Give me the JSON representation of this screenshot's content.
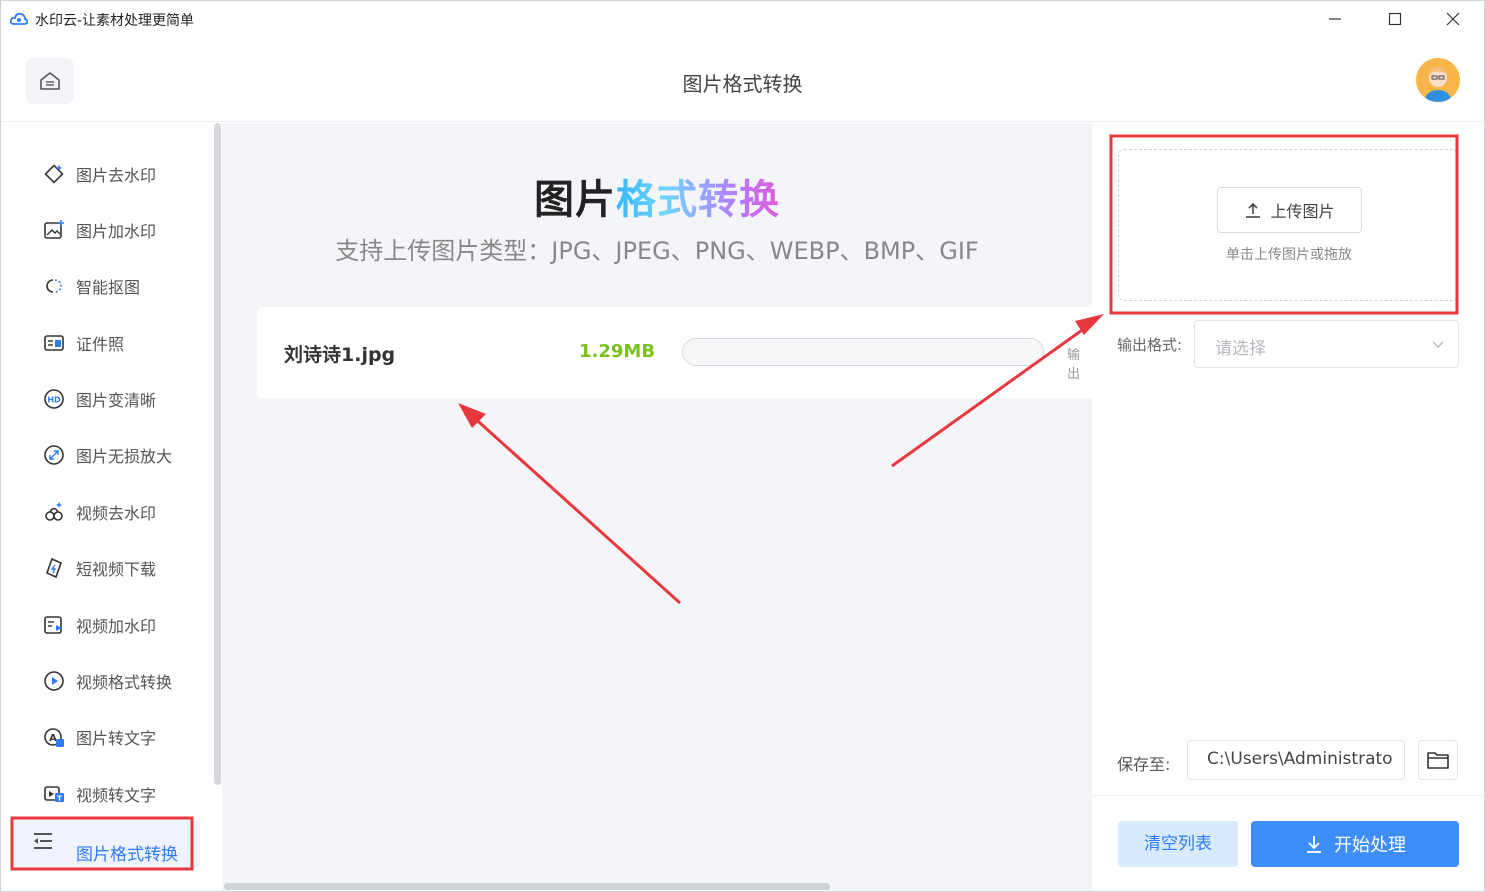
{
  "window": {
    "title": "水印云-让素材处理更简单"
  },
  "header": {
    "title": "图片格式转换"
  },
  "sidebar": {
    "items": [
      {
        "label": "图片去水印",
        "icon": "eraser-icon"
      },
      {
        "label": "图片加水印",
        "icon": "image-add-icon"
      },
      {
        "label": "智能抠图",
        "icon": "cutout-icon"
      },
      {
        "label": "证件照",
        "icon": "id-card-icon"
      },
      {
        "label": "图片变清晰",
        "icon": "hd-icon"
      },
      {
        "label": "图片无损放大",
        "icon": "enlarge-icon"
      },
      {
        "label": "视频去水印",
        "icon": "video-eraser-icon"
      },
      {
        "label": "短视频下载",
        "icon": "video-download-icon"
      },
      {
        "label": "视频加水印",
        "icon": "video-add-icon"
      },
      {
        "label": "视频格式转换",
        "icon": "play-circle-icon"
      },
      {
        "label": "图片转文字",
        "icon": "image-text-icon"
      },
      {
        "label": "视频转文字",
        "icon": "video-text-icon"
      },
      {
        "label": "图片格式转换",
        "icon": "convert-icon",
        "active": true
      }
    ]
  },
  "main": {
    "hero_title_plain": "图片",
    "hero_title_colored": "格式转换",
    "subtitle": "支持上传图片类型：JPG、JPEG、PNG、WEBP、BMP、GIF",
    "file": {
      "name": "刘诗诗1.jpg",
      "size": "1.29MB",
      "output_truncated": "输出"
    }
  },
  "panel": {
    "upload_button": "上传图片",
    "upload_hint": "单击上传图片或拖放",
    "format_label": "输出格式:",
    "format_placeholder": "请选择",
    "save_label": "保存至:",
    "save_path": "C:\\Users\\Administrato",
    "clear_button": "清空列表",
    "start_button": "开始处理"
  },
  "colors": {
    "accent": "#3d8ef8",
    "size_green": "#7ac21a",
    "annotation_red": "#e8383d"
  }
}
